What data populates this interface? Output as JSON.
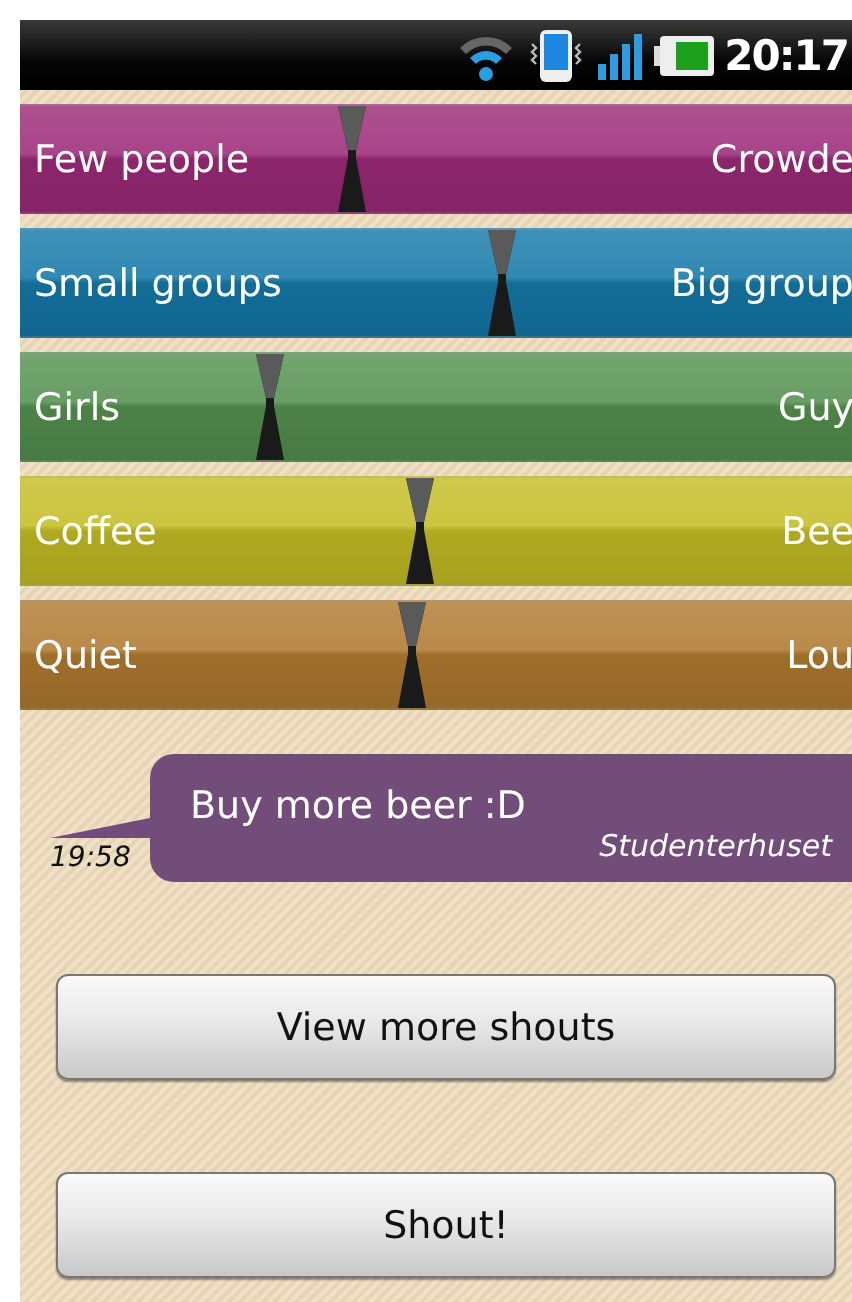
{
  "status_bar": {
    "time": "20:17"
  },
  "sliders": [
    {
      "left": "Few people",
      "right": "Crowde",
      "level": 0.4,
      "color": "#9c2a78"
    },
    {
      "left": "Small groups",
      "right": "Big group",
      "level": 0.58,
      "color": "#1479a8"
    },
    {
      "left": "Girls",
      "right": "Guy",
      "level": 0.3,
      "color": "#55904f"
    },
    {
      "left": "Coffee",
      "right": "Bee",
      "level": 0.48,
      "color": "#c4bd25"
    },
    {
      "left": "Quiet",
      "right": "Lou",
      "level": 0.47,
      "color": "#b07a30"
    }
  ],
  "shout": {
    "time": "19:58",
    "message": "Buy more beer :D",
    "author": "Studenterhuset"
  },
  "buttons": [
    "View more shouts",
    "Shout!"
  ]
}
